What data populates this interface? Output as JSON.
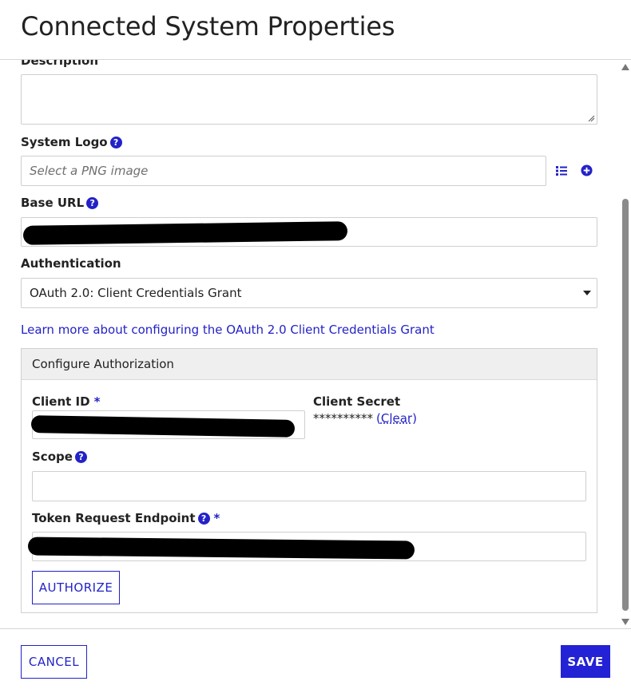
{
  "dialog": {
    "title": "Connected System Properties"
  },
  "fields": {
    "description": {
      "label": "Description",
      "value": ""
    },
    "system_logo": {
      "label": "System Logo",
      "help": "?",
      "placeholder": "Select a PNG image",
      "icons": [
        "list-icon",
        "add-circle-icon"
      ]
    },
    "base_url": {
      "label": "Base URL",
      "help": "?",
      "value": ""
    },
    "authentication": {
      "label": "Authentication",
      "value": "OAuth 2.0: Client Credentials Grant",
      "icon": "caret-down-icon"
    }
  },
  "learn_more_link": "Learn more about configuring the OAuth 2.0 Client Credentials Grant",
  "configure_authorization": {
    "title": "Configure Authorization",
    "client_id": {
      "label": "Client ID",
      "required": "*",
      "value": ""
    },
    "client_secret": {
      "label": "Client Secret",
      "masked": "**********",
      "clear_open": "(",
      "clear_label": "Clear",
      "clear_close": ")"
    },
    "scope": {
      "label": "Scope",
      "help": "?",
      "value": ""
    },
    "token_endpoint": {
      "label": "Token Request Endpoint",
      "help": "?",
      "required": "*",
      "value": ""
    },
    "authorize_label": "AUTHORIZE"
  },
  "footer": {
    "cancel_label": "CANCEL",
    "save_label": "SAVE"
  },
  "colors": {
    "accent": "#2322c7",
    "primary_button": "#2322d5",
    "section_header": "#efefef"
  }
}
